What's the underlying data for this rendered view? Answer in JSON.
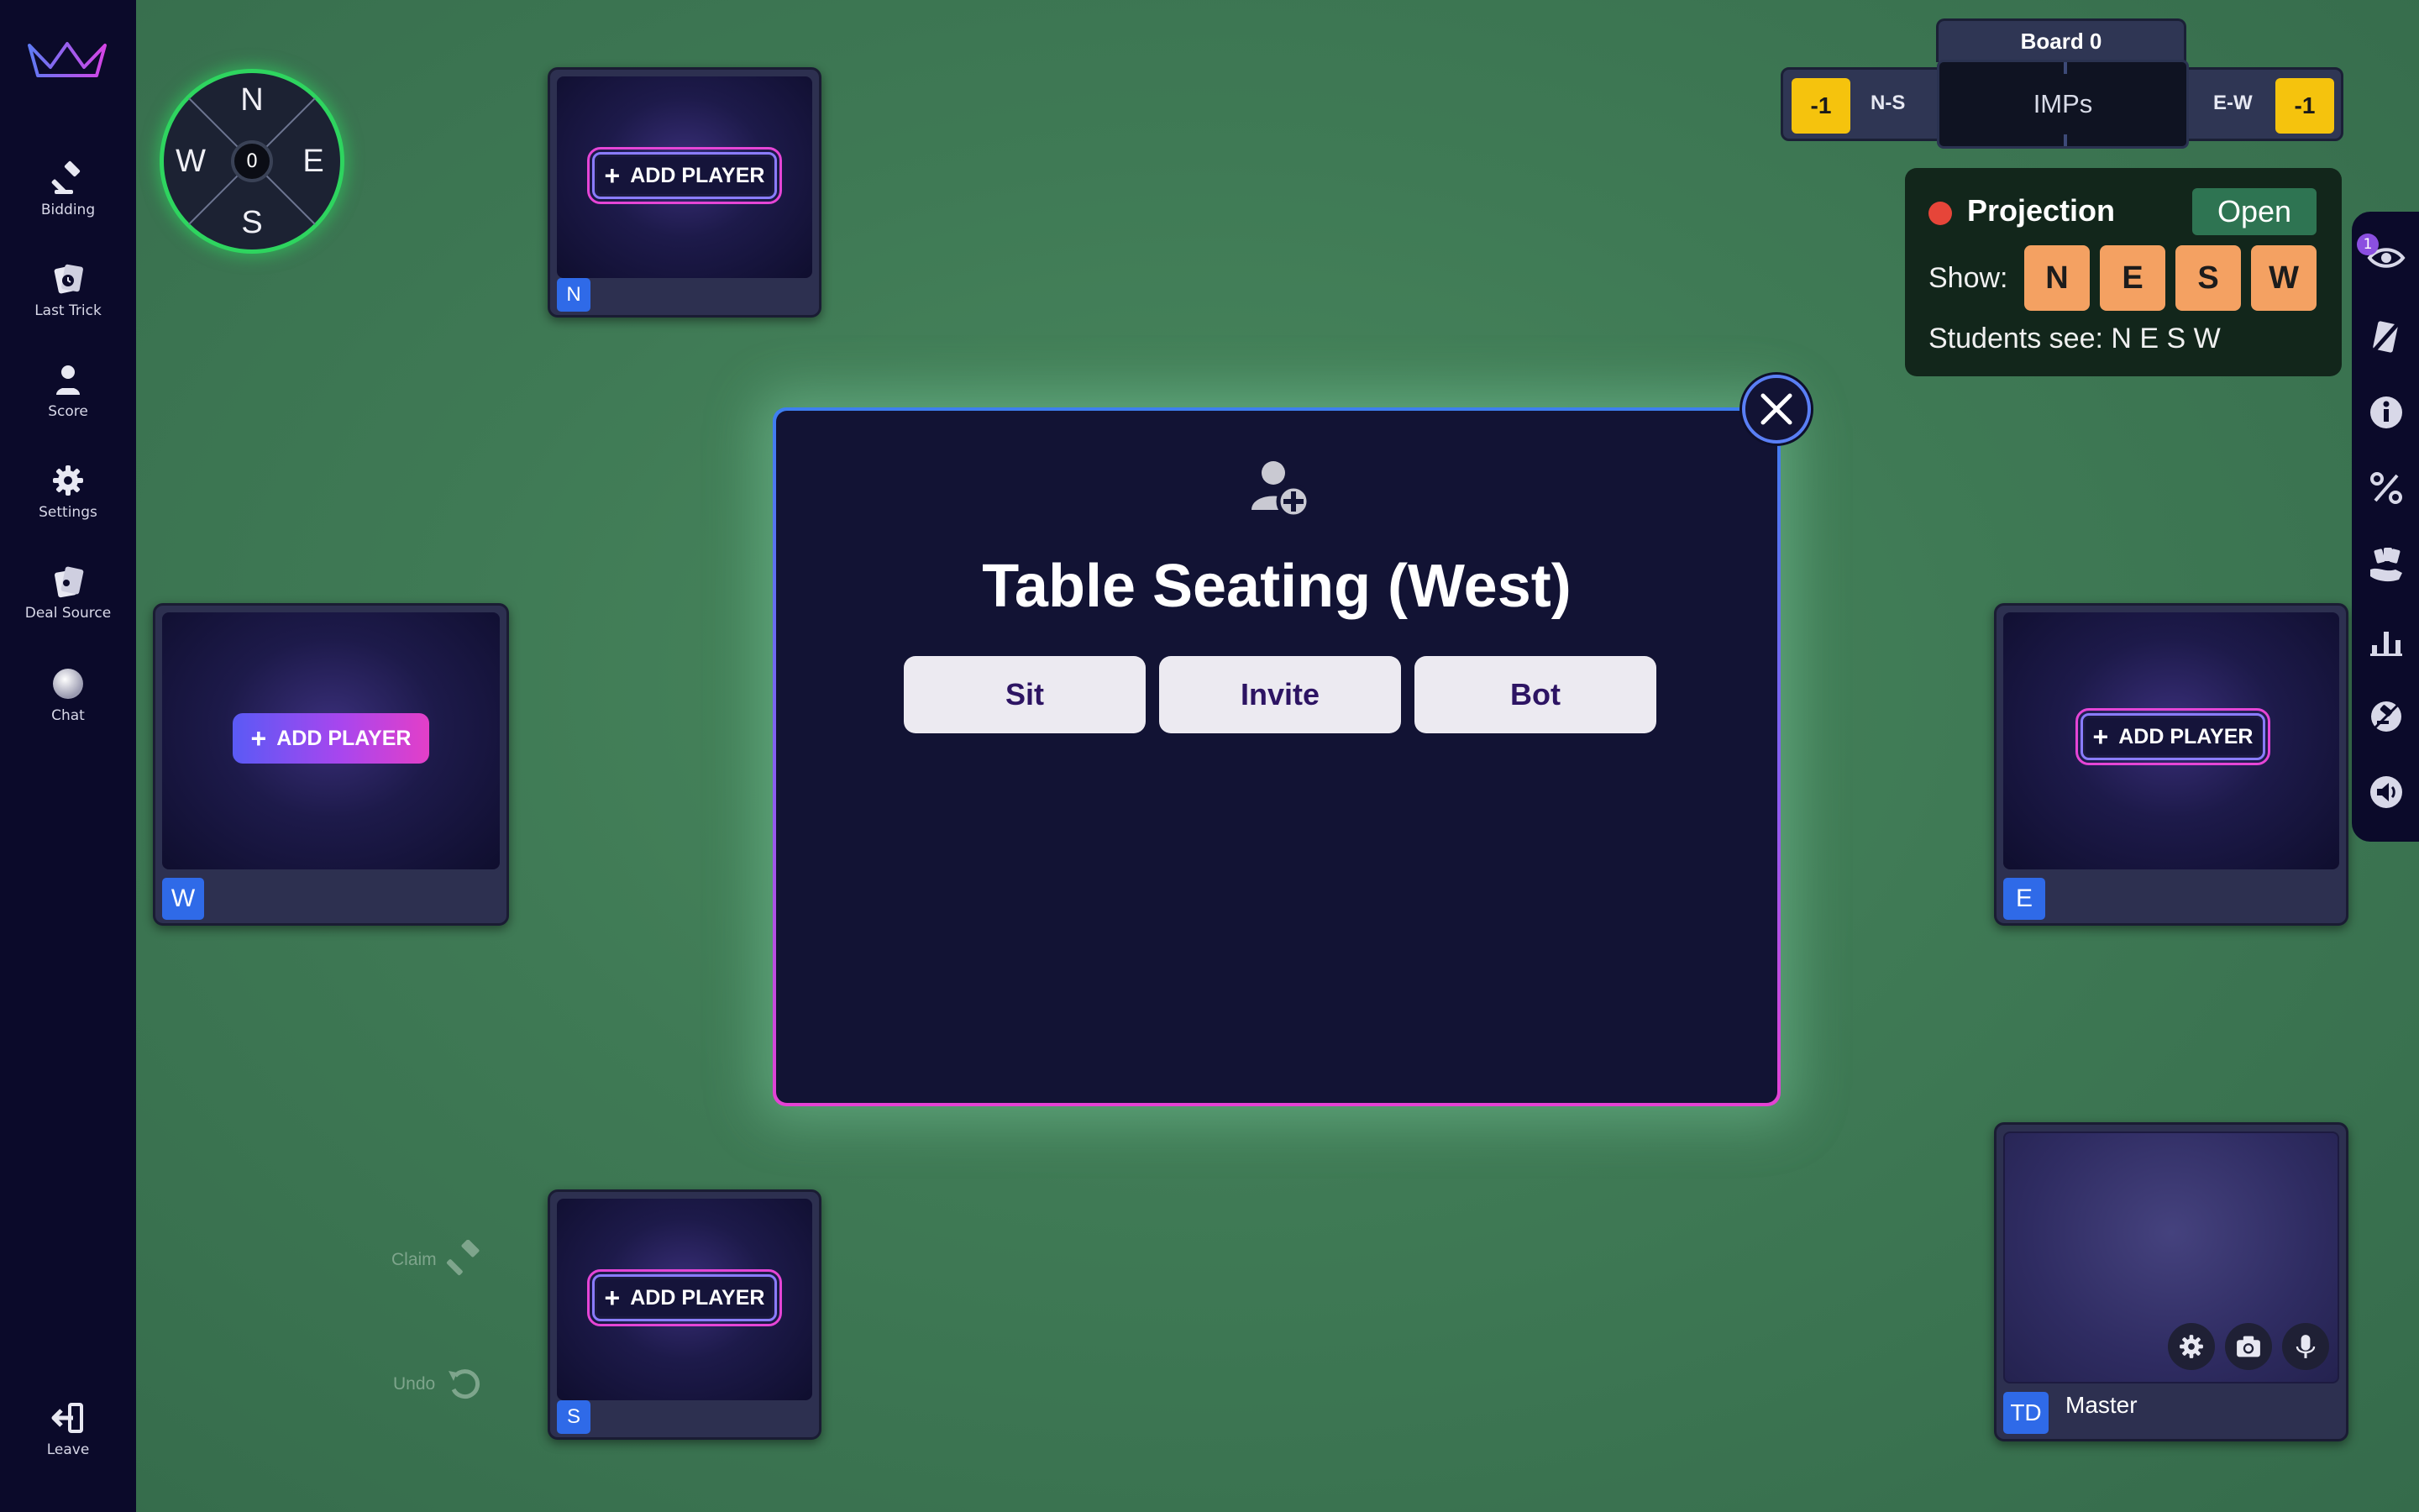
{
  "sidebar": {
    "items": [
      {
        "label": "Bidding",
        "icon": "gavel-icon"
      },
      {
        "label": "Last Trick",
        "icon": "last-trick-icon"
      },
      {
        "label": "Score",
        "icon": "score-icon"
      },
      {
        "label": "Settings",
        "icon": "gear-icon"
      },
      {
        "label": "Deal Source",
        "icon": "deal-source-icon"
      },
      {
        "label": "Chat",
        "icon": "chat-icon"
      }
    ],
    "leave_label": "Leave"
  },
  "compass": {
    "north": "N",
    "east": "E",
    "south": "S",
    "west": "W",
    "center": "0"
  },
  "seats": {
    "north": {
      "badge": "N",
      "button": "ADD PLAYER"
    },
    "west": {
      "badge": "W",
      "button": "ADD PLAYER"
    },
    "east": {
      "badge": "E",
      "button": "ADD PLAYER"
    },
    "south": {
      "badge": "S",
      "button": "ADD PLAYER"
    }
  },
  "scoreboard": {
    "board_label": "Board 0",
    "ns_score": "-1",
    "ns_label": "N-S",
    "scoring": "IMPs",
    "ew_label": "E-W",
    "ew_score": "-1"
  },
  "projection": {
    "title": "Projection",
    "status": "Open",
    "show_label": "Show:",
    "buttons": [
      "N",
      "E",
      "S",
      "W"
    ],
    "students_text": "Students see: N E S W"
  },
  "right_toolbar": {
    "badge_count": "1"
  },
  "modal": {
    "title": "Table Seating (West)",
    "buttons": [
      "Sit",
      "Invite",
      "Bot"
    ]
  },
  "actions": {
    "claim": "Claim",
    "undo": "Undo"
  },
  "master": {
    "badge": "TD",
    "name": "Master"
  },
  "colors": {
    "felt": "#3f7a55",
    "sidebar": "#0b0a2a",
    "seat_badge": "#2f6ae8",
    "score_box": "#f5c30d",
    "projection_button": "#f4a162",
    "open_button": "#2e7452",
    "compass_ring": "#2ed55f"
  }
}
